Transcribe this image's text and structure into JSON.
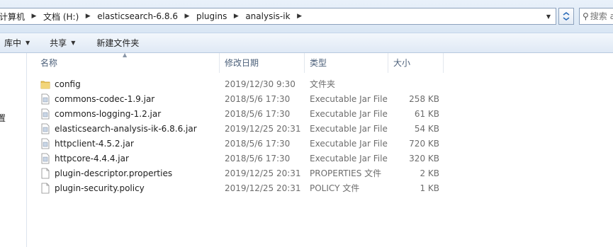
{
  "address_bar": {
    "crumbs": [
      "计算机",
      "文档 (H:)",
      "elasticsearch-6.8.6",
      "plugins",
      "analysis-ik"
    ],
    "search_placeholder": "搜索 analysis-ik"
  },
  "toolbar": {
    "items": [
      {
        "label": "库中",
        "has_dropdown": true
      },
      {
        "label": "共享",
        "has_dropdown": true
      },
      {
        "label": "新建文件夹",
        "has_dropdown": false
      }
    ]
  },
  "nav_pane": {
    "item_label": "置"
  },
  "columns": {
    "name": "名称",
    "date": "修改日期",
    "type": "类型",
    "size": "大小"
  },
  "files": [
    {
      "name": "config",
      "date": "2019/12/30 9:30",
      "type": "文件夹",
      "size": "",
      "icon": "folder-icon"
    },
    {
      "name": "commons-codec-1.9.jar",
      "date": "2018/5/6 17:30",
      "type": "Executable Jar File",
      "size": "258 KB",
      "icon": "jar-file-icon"
    },
    {
      "name": "commons-logging-1.2.jar",
      "date": "2018/5/6 17:30",
      "type": "Executable Jar File",
      "size": "61 KB",
      "icon": "jar-file-icon"
    },
    {
      "name": "elasticsearch-analysis-ik-6.8.6.jar",
      "date": "2019/12/25 20:31",
      "type": "Executable Jar File",
      "size": "54 KB",
      "icon": "jar-file-icon"
    },
    {
      "name": "httpclient-4.5.2.jar",
      "date": "2018/5/6 17:30",
      "type": "Executable Jar File",
      "size": "720 KB",
      "icon": "jar-file-icon"
    },
    {
      "name": "httpcore-4.4.4.jar",
      "date": "2018/5/6 17:30",
      "type": "Executable Jar File",
      "size": "320 KB",
      "icon": "jar-file-icon"
    },
    {
      "name": "plugin-descriptor.properties",
      "date": "2019/12/25 20:31",
      "type": "PROPERTIES 文件",
      "size": "2 KB",
      "icon": "blank-file-icon"
    },
    {
      "name": "plugin-security.policy",
      "date": "2019/12/25 20:31",
      "type": "POLICY 文件",
      "size": "1 KB",
      "icon": "blank-file-icon"
    }
  ],
  "colors": {
    "header_text": "#4c607a",
    "folder": "#e8c25a",
    "border": "#8da2bd"
  }
}
